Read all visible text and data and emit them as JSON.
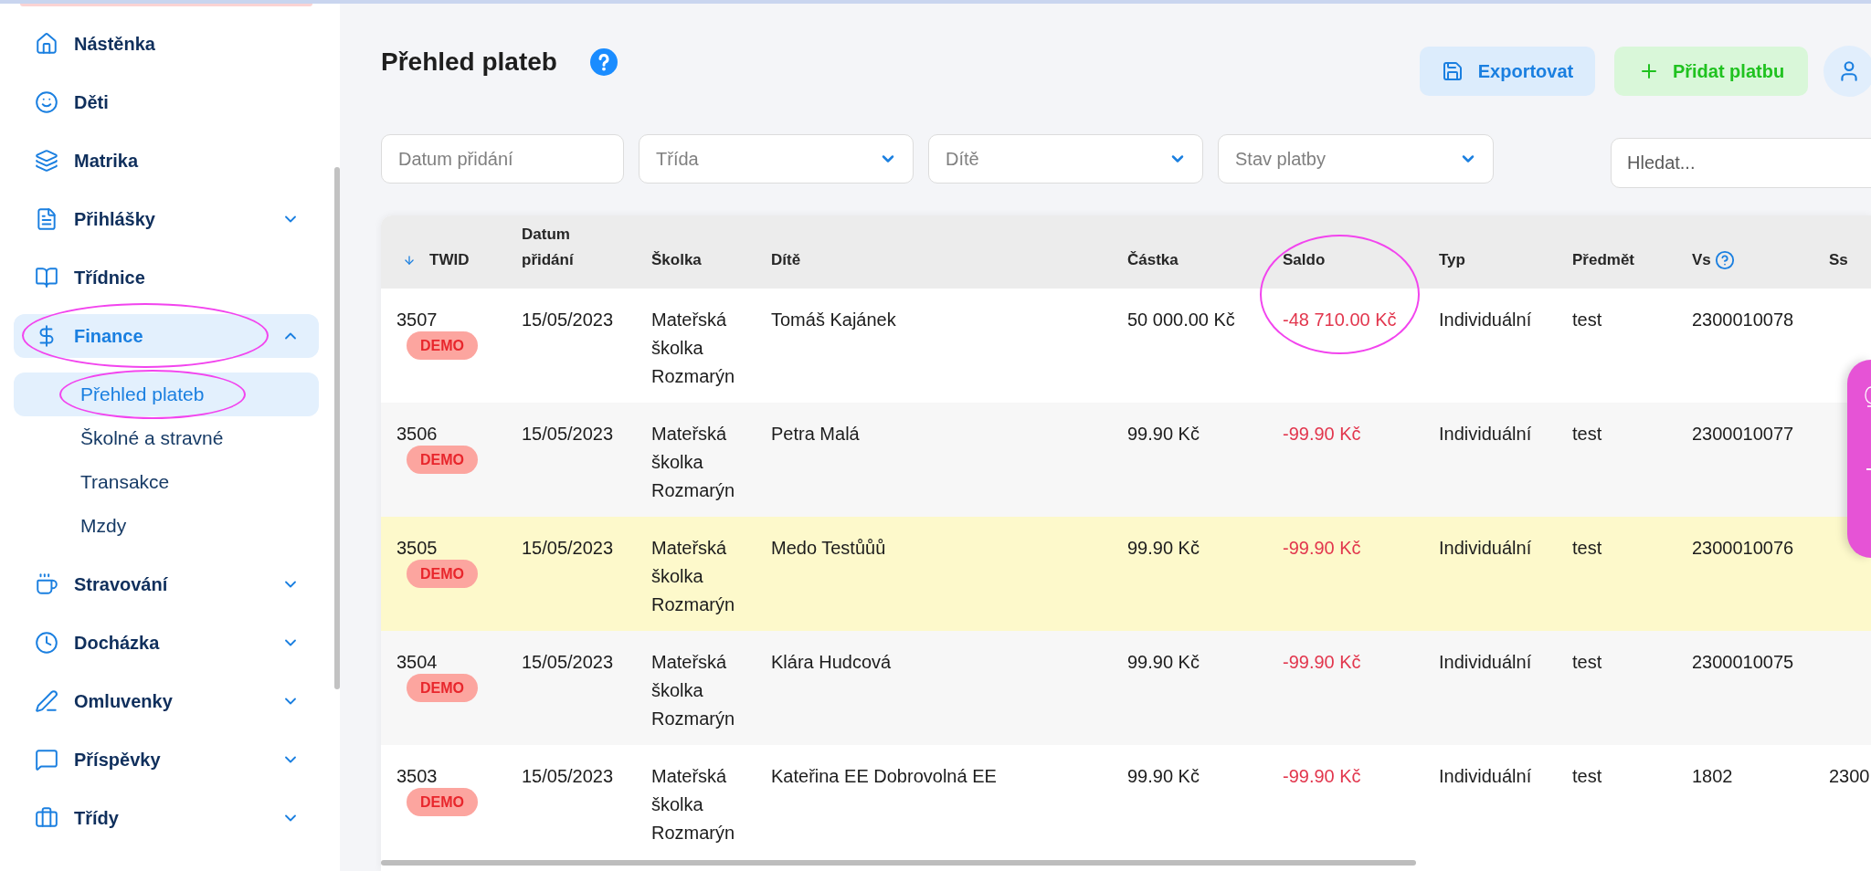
{
  "sidebar": {
    "items": [
      {
        "label": "Nástěnka",
        "expandable": false,
        "expanded": false,
        "selected": false,
        "circled": false
      },
      {
        "label": "Děti",
        "expandable": false,
        "expanded": false,
        "selected": false,
        "circled": false
      },
      {
        "label": "Matrika",
        "expandable": false,
        "expanded": false,
        "selected": false,
        "circled": false
      },
      {
        "label": "Přihlášky",
        "expandable": true,
        "expanded": false,
        "selected": false,
        "circled": false
      },
      {
        "label": "Třídnice",
        "expandable": false,
        "expanded": false,
        "selected": false,
        "circled": false
      },
      {
        "label": "Finance",
        "expandable": true,
        "expanded": true,
        "selected": true,
        "circled": true,
        "children": [
          {
            "label": "Přehled plateb",
            "selected": true,
            "circled": true
          },
          {
            "label": "Školné a stravné",
            "selected": false,
            "circled": false
          },
          {
            "label": "Transakce",
            "selected": false,
            "circled": false
          },
          {
            "label": "Mzdy",
            "selected": false,
            "circled": false
          }
        ]
      },
      {
        "label": "Stravování",
        "expandable": true,
        "expanded": false,
        "selected": false,
        "circled": false
      },
      {
        "label": "Docházka",
        "expandable": true,
        "expanded": false,
        "selected": false,
        "circled": false
      },
      {
        "label": "Omluvenky",
        "expandable": true,
        "expanded": false,
        "selected": false,
        "circled": false
      },
      {
        "label": "Příspěvky",
        "expandable": true,
        "expanded": false,
        "selected": false,
        "circled": false
      },
      {
        "label": "Třídy",
        "expandable": true,
        "expanded": false,
        "selected": false,
        "circled": false
      }
    ]
  },
  "page": {
    "title": "Přehled plateb",
    "actions": [
      {
        "kind": "export",
        "label": "Exportovat"
      },
      {
        "kind": "add",
        "label": "Přidat platbu"
      }
    ]
  },
  "filters": [
    {
      "kind": "input",
      "placeholder": "Datum přidání"
    },
    {
      "kind": "select",
      "placeholder": "Třída"
    },
    {
      "kind": "select",
      "placeholder": "Dítě"
    },
    {
      "kind": "select",
      "placeholder": "Stav platby"
    }
  ],
  "search": {
    "placeholder": "Hledat..."
  },
  "table": {
    "columns": [
      {
        "label": "TWID",
        "kind": "id",
        "sorted": true,
        "help": false
      },
      {
        "label": "Datum přidání",
        "kind": "text",
        "sorted": false,
        "help": false
      },
      {
        "label": "Školka",
        "kind": "text",
        "sorted": false,
        "help": false
      },
      {
        "label": "Dítě",
        "kind": "text",
        "sorted": false,
        "help": false
      },
      {
        "label": "Částka",
        "kind": "text",
        "sorted": false,
        "help": false
      },
      {
        "label": "Saldo",
        "kind": "saldo",
        "sorted": false,
        "help": false
      },
      {
        "label": "Typ",
        "kind": "text",
        "sorted": false,
        "help": false
      },
      {
        "label": "Předmět",
        "kind": "text",
        "sorted": false,
        "help": false
      },
      {
        "label": "Vs",
        "kind": "text",
        "sorted": false,
        "help": true
      },
      {
        "label": "Ss",
        "kind": "text",
        "sorted": false,
        "help": false
      }
    ],
    "rows": [
      {
        "twid": "3507",
        "badge": "DEMO",
        "values": [
          "15/05/2023",
          "Mateřská školka Rozmarýn",
          "Tomáš Kajánek",
          "50 000.00 Kč",
          "-48 710.00 Kč",
          "Individuální",
          "test",
          "2300010078"
        ],
        "highlighted": false,
        "saldo_circled": true
      },
      {
        "twid": "3506",
        "badge": "DEMO",
        "values": [
          "15/05/2023",
          "Mateřská školka Rozmarýn",
          "Petra Malá",
          "99.90 Kč",
          "-99.90 Kč",
          "Individuální",
          "test",
          "2300010077"
        ],
        "highlighted": false,
        "saldo_circled": false
      },
      {
        "twid": "3505",
        "badge": "DEMO",
        "values": [
          "15/05/2023",
          "Mateřská školka Rozmarýn",
          "Medo Testůůů",
          "99.90 Kč",
          "-99.90 Kč",
          "Individuální",
          "test",
          "2300010076"
        ],
        "highlighted": true,
        "saldo_circled": false
      },
      {
        "twid": "3504",
        "badge": "DEMO",
        "values": [
          "15/05/2023",
          "Mateřská školka Rozmarýn",
          "Klára Hudcová",
          "99.90 Kč",
          "-99.90 Kč",
          "Individuální",
          "test",
          "2300010075"
        ],
        "highlighted": false,
        "saldo_circled": false
      },
      {
        "twid": "3503",
        "badge": "DEMO",
        "values": [
          "15/05/2023",
          "Mateřská školka Rozmarýn",
          "Kateřina EE Dobrovolná EE",
          "99.90 Kč",
          "-99.90 Kč",
          "Individuální",
          "test",
          "1802",
          "2300"
        ],
        "highlighted": false,
        "saldo_circled": false
      }
    ]
  }
}
